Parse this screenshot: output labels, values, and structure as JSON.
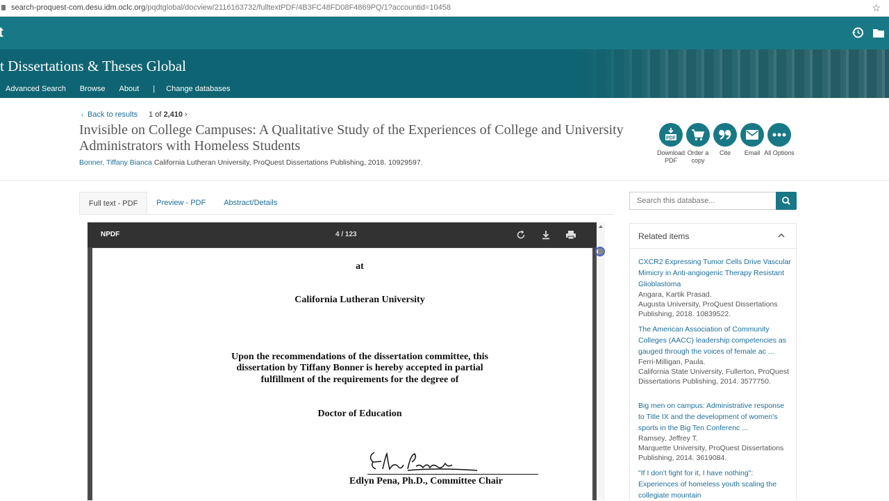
{
  "browser": {
    "url_host": "search-proquest-com.desu.idm.oclc.org",
    "url_path": "/pqdtglobal/docview/2116163732/fulltextPDF/4B3FC48FD08F4869PQ/1?accountid=10458"
  },
  "topbar": {
    "logo": "t"
  },
  "banner": {
    "title": "t Dissertations & Theses Global",
    "nav": [
      "Advanced Search",
      "Browse",
      "About",
      "|",
      "Change databases"
    ]
  },
  "header": {
    "back_label": "Back to results",
    "pager_current": "1",
    "pager_of": "of",
    "pager_total": "2,410",
    "title": "Invisible on College Campuses: A Qualitative Study of the Experiences of College and University Administrators with Homeless Students",
    "author": "Bonner, Tiffany Bianca",
    "citation": "California Lutheran University, ProQuest Dissertations Publishing, 2018. 10929597."
  },
  "actions": [
    {
      "label": "Download PDF",
      "icon": "download-pdf-icon"
    },
    {
      "label": "Order a copy",
      "icon": "cart-icon"
    },
    {
      "label": "Cite",
      "icon": "quote-icon"
    },
    {
      "label": "Email",
      "icon": "email-icon"
    },
    {
      "label": "All Options",
      "icon": "more-icon"
    }
  ],
  "tabs": [
    "Full text - PDF",
    "Preview - PDF",
    "Abstract/Details"
  ],
  "viewer": {
    "brand": "NPDF",
    "page_indicator": "4 / 123",
    "lines": {
      "at": "at",
      "university": "California Lutheran University",
      "rec1": "Upon the recommendations of the dissertation committee, this",
      "rec2": "dissertation by Tiffany Bonner is hereby accepted in partial",
      "rec3": "fulfillment of the requirements for the degree of",
      "degree": "Doctor of Education",
      "signature": "Edlyn Pena",
      "chair": "Edlyn Pena, Ph.D., Committee Chair"
    }
  },
  "search": {
    "placeholder": "Search this database..."
  },
  "related": {
    "header": "Related items",
    "items": [
      {
        "title": "CXCR2 Expressing Tumor Cells Drive Vascular Mimicry in Anti-angiogenic Therapy Resistant Glioblastoma",
        "author": "Angara, Kartik Prasad.",
        "pub": "Augusta University, ProQuest Dissertations Publishing, 2018. 10839522."
      },
      {
        "title": "The American Association of Community Colleges (AACC) leadership competencies as gauged through the voices of female ac ...",
        "author": "Ferri-Milligan, Paula.",
        "pub": "California State University, Fullerton, ProQuest Dissertations Publishing, 2014. 3577750."
      },
      {
        "title": "Big men on campus: Administrative response to Title IX and the development of women's sports in the Big Ten Conferenc ...",
        "author": "Ramsey, Jeffrey T.",
        "pub": "Marquette University, ProQuest Dissertations Publishing, 2014. 3619084."
      },
      {
        "title": "\"If I don't fight for it, I have nothing\": Experiences of homeless youth scaling the collegiate mountain",
        "author": "",
        "pub": ""
      }
    ]
  },
  "colors": {
    "brand": "#197885",
    "banner": "#0e6472",
    "link": "#1c6e9a"
  }
}
